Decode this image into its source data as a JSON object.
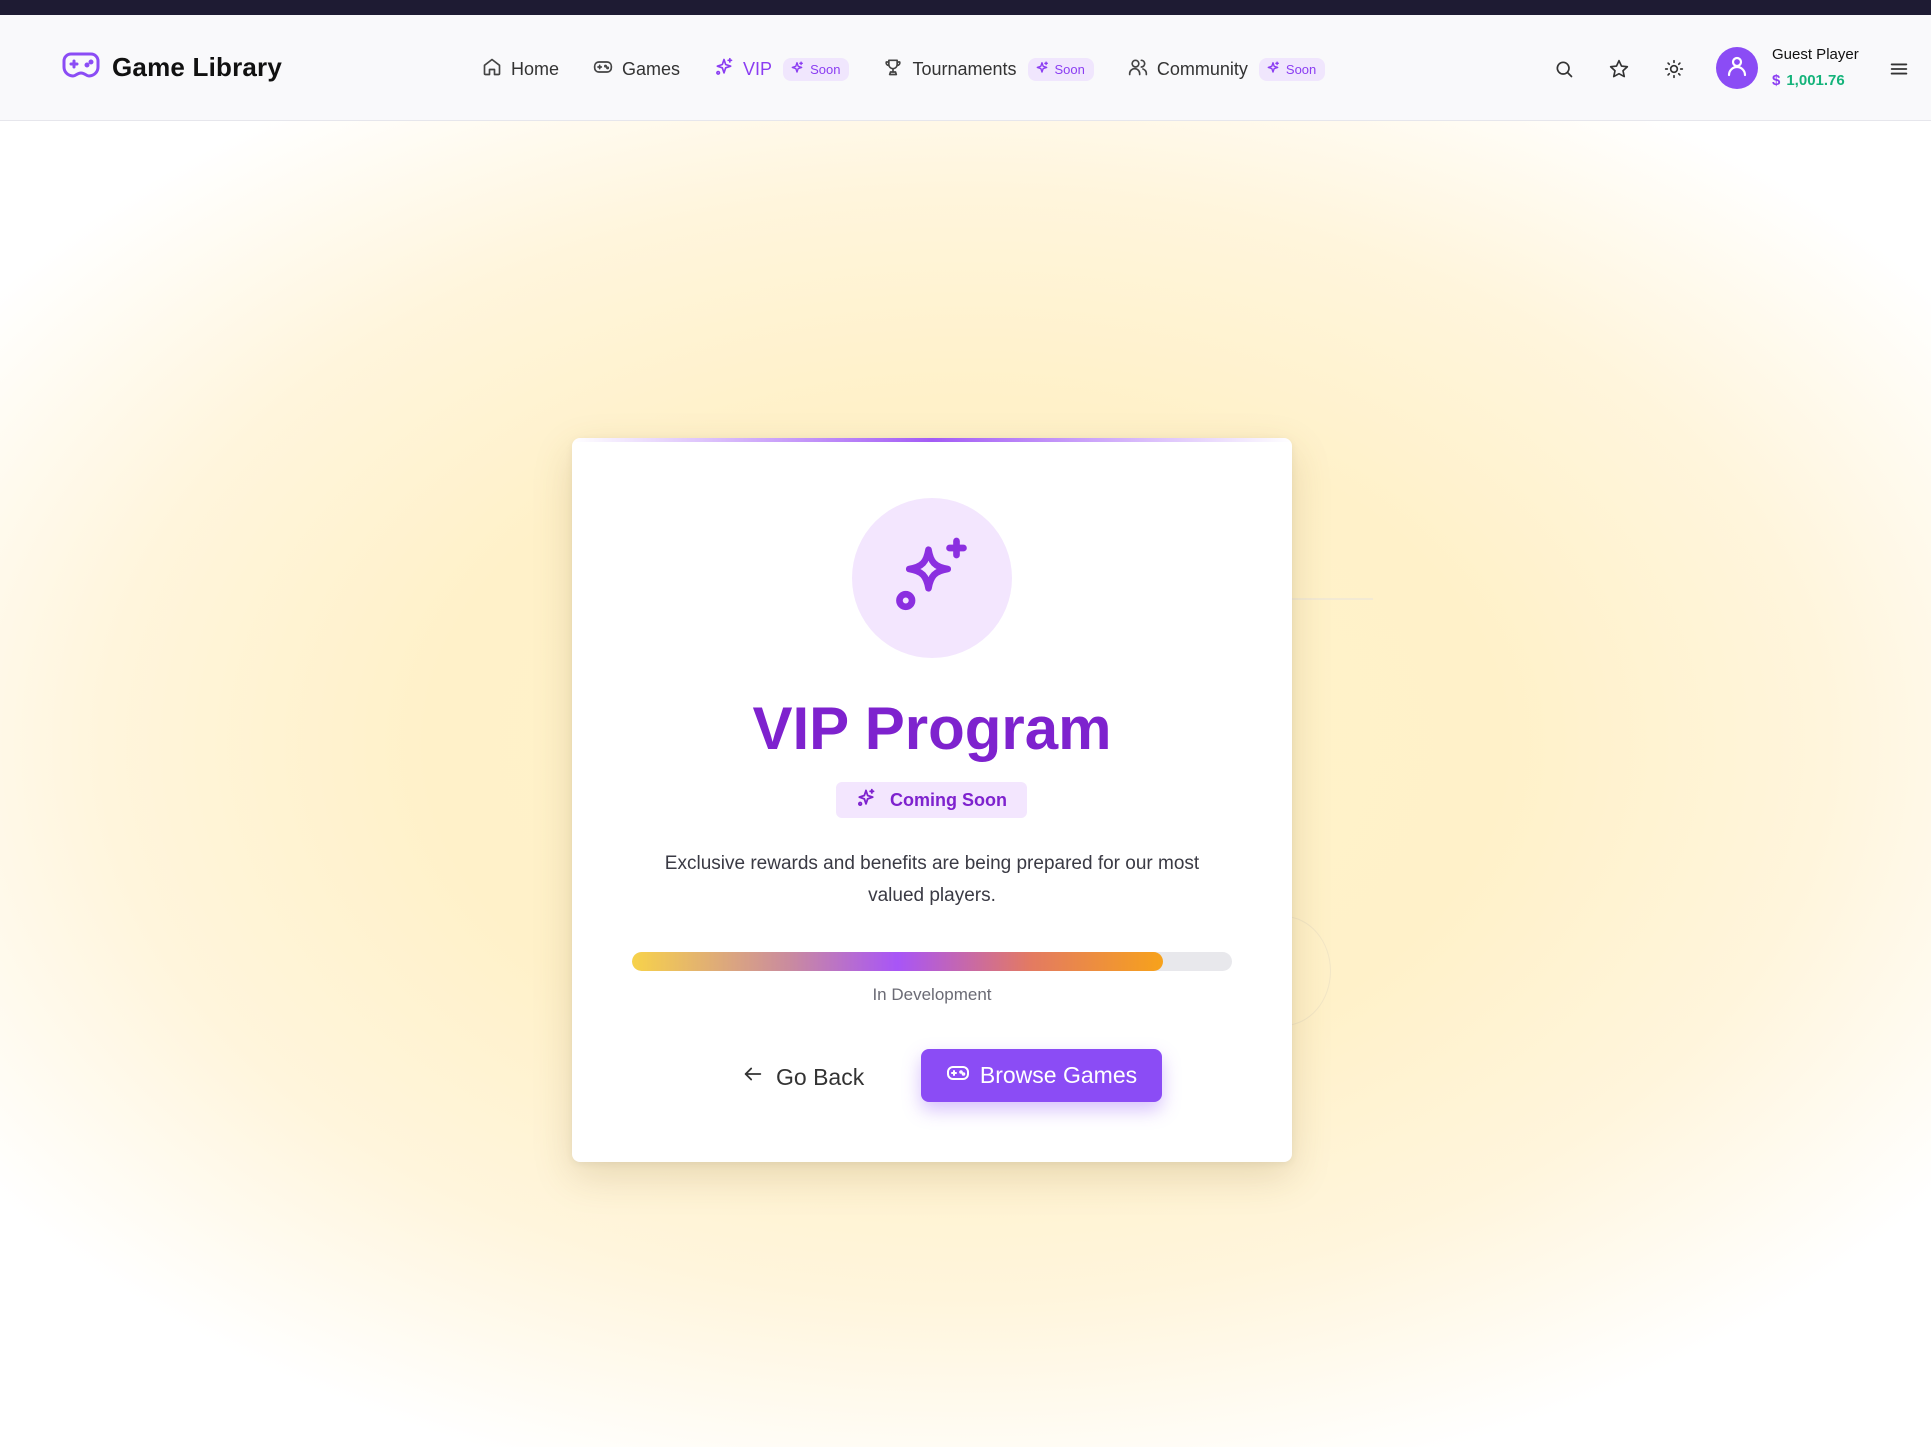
{
  "header": {
    "brand_title": "Game Library",
    "nav": [
      {
        "label": "Home",
        "icon": "home-icon",
        "active": false,
        "badge": ""
      },
      {
        "label": "Games",
        "icon": "gamepad-icon",
        "active": false,
        "badge": ""
      },
      {
        "label": "VIP",
        "icon": "sparkles-icon",
        "active": true,
        "badge": "Soon"
      },
      {
        "label": "Tournaments",
        "icon": "trophy-icon",
        "active": false,
        "badge": "Soon"
      },
      {
        "label": "Community",
        "icon": "users-icon",
        "active": false,
        "badge": "Soon"
      }
    ],
    "actions": [
      "search-icon",
      "star-icon",
      "sun-icon",
      "menu-icon"
    ],
    "user": {
      "name": "Guest Player",
      "currency": "$",
      "balance": "1,001.76"
    }
  },
  "card": {
    "title": "VIP Program",
    "status_label": "Coming Soon",
    "description": "Exclusive rewards and benefits are being prepared for our most valued players.",
    "progress_percent": 88.5,
    "progress_label": "In Development",
    "back_label": "Go Back",
    "browse_label": "Browse Games"
  },
  "colors": {
    "accent": "#8b4cf5",
    "title": "#7e22ce",
    "balance": "#14b37a",
    "badge_bg": "#f0e6fd"
  }
}
